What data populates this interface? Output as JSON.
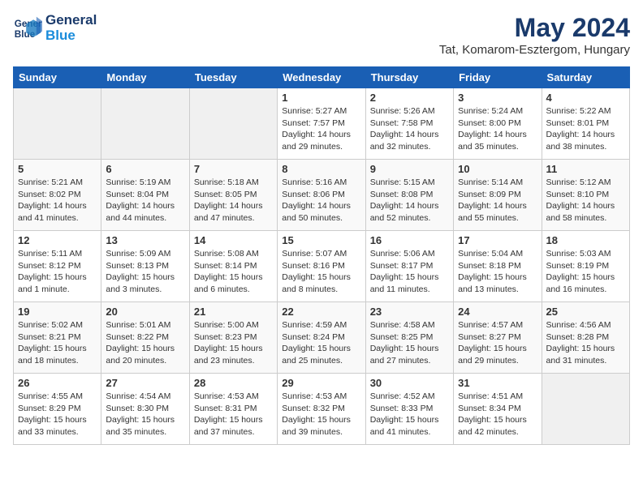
{
  "header": {
    "logo_line1": "General",
    "logo_line2": "Blue",
    "month": "May 2024",
    "location": "Tat, Komarom-Esztergom, Hungary"
  },
  "days_of_week": [
    "Sunday",
    "Monday",
    "Tuesday",
    "Wednesday",
    "Thursday",
    "Friday",
    "Saturday"
  ],
  "weeks": [
    [
      {
        "day": "",
        "info": ""
      },
      {
        "day": "",
        "info": ""
      },
      {
        "day": "",
        "info": ""
      },
      {
        "day": "1",
        "info": "Sunrise: 5:27 AM\nSunset: 7:57 PM\nDaylight: 14 hours\nand 29 minutes."
      },
      {
        "day": "2",
        "info": "Sunrise: 5:26 AM\nSunset: 7:58 PM\nDaylight: 14 hours\nand 32 minutes."
      },
      {
        "day": "3",
        "info": "Sunrise: 5:24 AM\nSunset: 8:00 PM\nDaylight: 14 hours\nand 35 minutes."
      },
      {
        "day": "4",
        "info": "Sunrise: 5:22 AM\nSunset: 8:01 PM\nDaylight: 14 hours\nand 38 minutes."
      }
    ],
    [
      {
        "day": "5",
        "info": "Sunrise: 5:21 AM\nSunset: 8:02 PM\nDaylight: 14 hours\nand 41 minutes."
      },
      {
        "day": "6",
        "info": "Sunrise: 5:19 AM\nSunset: 8:04 PM\nDaylight: 14 hours\nand 44 minutes."
      },
      {
        "day": "7",
        "info": "Sunrise: 5:18 AM\nSunset: 8:05 PM\nDaylight: 14 hours\nand 47 minutes."
      },
      {
        "day": "8",
        "info": "Sunrise: 5:16 AM\nSunset: 8:06 PM\nDaylight: 14 hours\nand 50 minutes."
      },
      {
        "day": "9",
        "info": "Sunrise: 5:15 AM\nSunset: 8:08 PM\nDaylight: 14 hours\nand 52 minutes."
      },
      {
        "day": "10",
        "info": "Sunrise: 5:14 AM\nSunset: 8:09 PM\nDaylight: 14 hours\nand 55 minutes."
      },
      {
        "day": "11",
        "info": "Sunrise: 5:12 AM\nSunset: 8:10 PM\nDaylight: 14 hours\nand 58 minutes."
      }
    ],
    [
      {
        "day": "12",
        "info": "Sunrise: 5:11 AM\nSunset: 8:12 PM\nDaylight: 15 hours\nand 1 minute."
      },
      {
        "day": "13",
        "info": "Sunrise: 5:09 AM\nSunset: 8:13 PM\nDaylight: 15 hours\nand 3 minutes."
      },
      {
        "day": "14",
        "info": "Sunrise: 5:08 AM\nSunset: 8:14 PM\nDaylight: 15 hours\nand 6 minutes."
      },
      {
        "day": "15",
        "info": "Sunrise: 5:07 AM\nSunset: 8:16 PM\nDaylight: 15 hours\nand 8 minutes."
      },
      {
        "day": "16",
        "info": "Sunrise: 5:06 AM\nSunset: 8:17 PM\nDaylight: 15 hours\nand 11 minutes."
      },
      {
        "day": "17",
        "info": "Sunrise: 5:04 AM\nSunset: 8:18 PM\nDaylight: 15 hours\nand 13 minutes."
      },
      {
        "day": "18",
        "info": "Sunrise: 5:03 AM\nSunset: 8:19 PM\nDaylight: 15 hours\nand 16 minutes."
      }
    ],
    [
      {
        "day": "19",
        "info": "Sunrise: 5:02 AM\nSunset: 8:21 PM\nDaylight: 15 hours\nand 18 minutes."
      },
      {
        "day": "20",
        "info": "Sunrise: 5:01 AM\nSunset: 8:22 PM\nDaylight: 15 hours\nand 20 minutes."
      },
      {
        "day": "21",
        "info": "Sunrise: 5:00 AM\nSunset: 8:23 PM\nDaylight: 15 hours\nand 23 minutes."
      },
      {
        "day": "22",
        "info": "Sunrise: 4:59 AM\nSunset: 8:24 PM\nDaylight: 15 hours\nand 25 minutes."
      },
      {
        "day": "23",
        "info": "Sunrise: 4:58 AM\nSunset: 8:25 PM\nDaylight: 15 hours\nand 27 minutes."
      },
      {
        "day": "24",
        "info": "Sunrise: 4:57 AM\nSunset: 8:27 PM\nDaylight: 15 hours\nand 29 minutes."
      },
      {
        "day": "25",
        "info": "Sunrise: 4:56 AM\nSunset: 8:28 PM\nDaylight: 15 hours\nand 31 minutes."
      }
    ],
    [
      {
        "day": "26",
        "info": "Sunrise: 4:55 AM\nSunset: 8:29 PM\nDaylight: 15 hours\nand 33 minutes."
      },
      {
        "day": "27",
        "info": "Sunrise: 4:54 AM\nSunset: 8:30 PM\nDaylight: 15 hours\nand 35 minutes."
      },
      {
        "day": "28",
        "info": "Sunrise: 4:53 AM\nSunset: 8:31 PM\nDaylight: 15 hours\nand 37 minutes."
      },
      {
        "day": "29",
        "info": "Sunrise: 4:53 AM\nSunset: 8:32 PM\nDaylight: 15 hours\nand 39 minutes."
      },
      {
        "day": "30",
        "info": "Sunrise: 4:52 AM\nSunset: 8:33 PM\nDaylight: 15 hours\nand 41 minutes."
      },
      {
        "day": "31",
        "info": "Sunrise: 4:51 AM\nSunset: 8:34 PM\nDaylight: 15 hours\nand 42 minutes."
      },
      {
        "day": "",
        "info": ""
      }
    ]
  ]
}
